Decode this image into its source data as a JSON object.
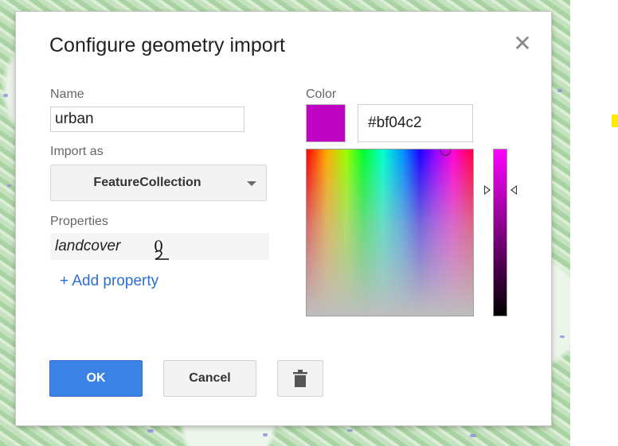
{
  "dialog": {
    "title": "Configure geometry import",
    "close_glyph": "✕",
    "close_icon": "close-icon"
  },
  "form": {
    "name_label": "Name",
    "name_value": "urban",
    "import_as_label": "Import as",
    "import_as_value": "FeatureCollection",
    "properties_label": "Properties",
    "properties": [
      {
        "key": "landcover",
        "value": "0"
      }
    ],
    "add_property_label": "+ Add property"
  },
  "color": {
    "label": "Color",
    "hex_value": "#bf04c2",
    "swatch_color": "#bf04c2"
  },
  "buttons": {
    "ok_label": "OK",
    "cancel_label": "Cancel",
    "delete_icon": "trash-icon"
  }
}
